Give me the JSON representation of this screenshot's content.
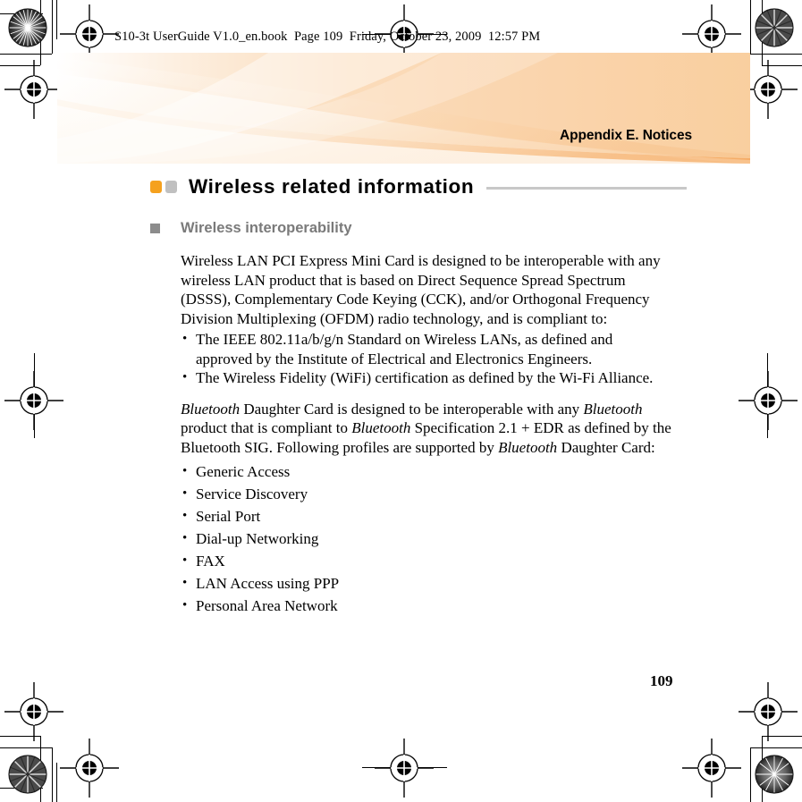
{
  "document_header": {
    "text": "S10-3t UserGuide V1.0_en.book  Page 109  Friday, October 23, 2009  12:57 PM"
  },
  "banner": {
    "title": "Appendix E. Notices",
    "colors": {
      "light": "#FDEEDC",
      "mid": "#FBD9B4",
      "deep": "#F6B067",
      "edge": "#F4A254"
    }
  },
  "section": {
    "title": "Wireless related information",
    "bullet_colors": {
      "orange": "#F5A11E",
      "gray": "#C0C0C0"
    },
    "rule_color": "#C8C8C8"
  },
  "subsection": {
    "heading": "Wireless interoperability",
    "bullet_color": "#8C8C8C",
    "text_color": "#7A7A7A"
  },
  "body": {
    "paragraph_1": "Wireless LAN PCI Express Mini Card is designed to be interoperable with any wireless LAN product that is based on Direct Sequence Spread Spectrum (DSSS), Complementary Code Keying (CCK), and/or Orthogonal Frequency Division Multiplexing (OFDM) radio technology, and is compliant to:",
    "standards_list": [
      "The IEEE 802.11a/b/g/n Standard on Wireless LANs, as defined and approved by the Institute of Electrical and Electronics Engineers.",
      "The Wireless Fidelity (WiFi) certification as defined by the Wi-Fi Alliance."
    ],
    "bluetooth_paragraph": {
      "segments": [
        {
          "text": "Bluetooth",
          "italic": true
        },
        {
          "text": " Daughter Card is designed to be interoperable with any ",
          "italic": false
        },
        {
          "text": "Bluetooth",
          "italic": true
        },
        {
          "text": " product that is compliant to ",
          "italic": false
        },
        {
          "text": "Bluetooth",
          "italic": true
        },
        {
          "text": " Specification 2.1 + EDR as defined by the Bluetooth SIG. Following profiles are supported by ",
          "italic": false
        },
        {
          "text": "Bluetooth",
          "italic": true
        },
        {
          "text": " Daughter Card:",
          "italic": false
        }
      ]
    },
    "profiles_list": [
      "Generic Access",
      "Service Discovery",
      "Serial Port",
      "Dial-up Networking",
      "FAX",
      "LAN Access using PPP",
      "Personal Area Network"
    ]
  },
  "footer": {
    "page_number": "109"
  }
}
